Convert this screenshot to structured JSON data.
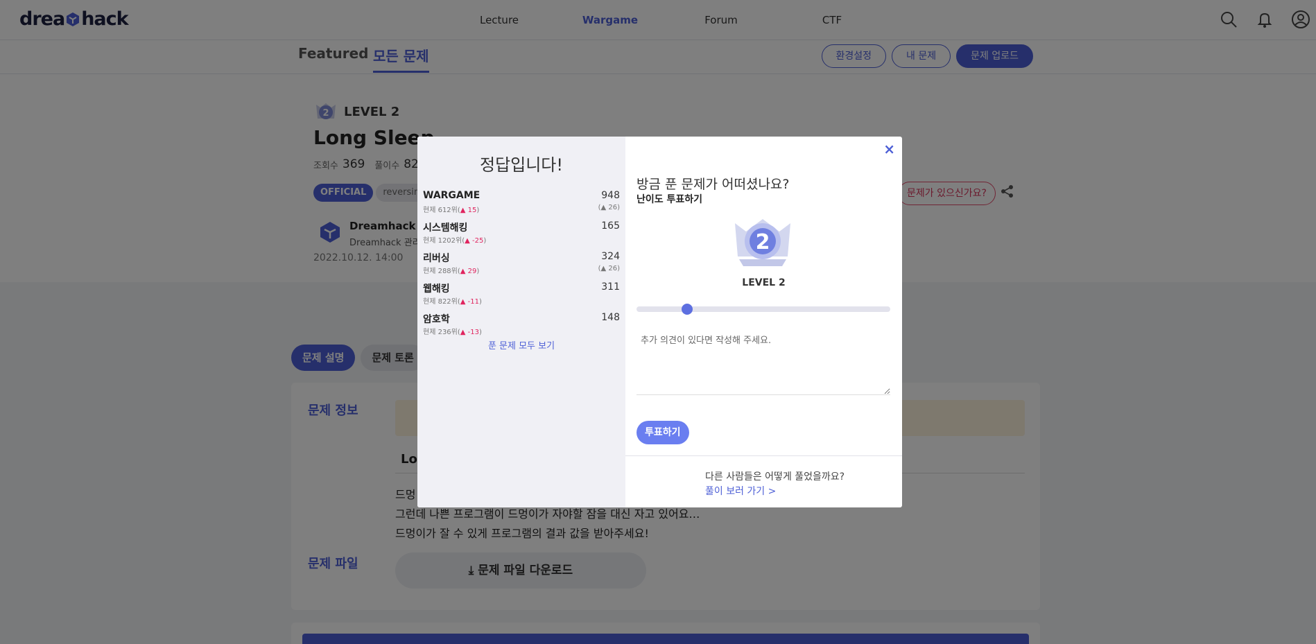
{
  "nav": {
    "logo_left": "drea",
    "logo_right": "hack",
    "links": [
      "Lecture",
      "Wargame",
      "Forum",
      "CTF"
    ],
    "active": "Wargame"
  },
  "subnav": {
    "tabs": [
      "Featured",
      "모든 문제"
    ],
    "buttons": [
      "환경설정",
      "내 문제",
      "문제 업로드"
    ]
  },
  "challenge": {
    "level": "LEVEL 2",
    "title": "Long Sleep",
    "views_label": "조회수",
    "views": "369",
    "solves_label": "풀이수",
    "solves": "82",
    "tags": [
      "OFFICIAL",
      "reversing"
    ],
    "report": "문제가 있으신가요?",
    "author": "Dreamhack",
    "author_role": "Dreamhack 관리자",
    "date": "2022.10.12. 14:00"
  },
  "content": {
    "tabs": [
      "문제 설명",
      "문제 토론"
    ],
    "info_label": "문제 정보",
    "name_partial": "Lo",
    "desc_lines": [
      "드멍",
      "그런데 나쁜 프로그램이 드멍이가 자야할 잠을 대신 자고 있어요…",
      "드멍이가 잘 수 있게 프로그램의 결과 값을 받아주세요!"
    ],
    "file_label": "문제 파일",
    "download": "문제 파일 다운로드"
  },
  "modal": {
    "correct": "정답입니다!",
    "scores": [
      {
        "category": "WARGAME",
        "score": "948",
        "rank": "현제 612위(",
        "change": "▲ 15",
        "close": ")",
        "total": "(▲ 26)"
      },
      {
        "category": "시스템해킹",
        "score": "165",
        "rank": "현제 1202위(",
        "change": "▲ -25",
        "close": ")",
        "total": ""
      },
      {
        "category": "리버싱",
        "score": "324",
        "rank": "현제 288위(",
        "change": "▲ 29",
        "close": ")",
        "total": "(▲ 26)"
      },
      {
        "category": "웹해킹",
        "score": "311",
        "rank": "현제 822위(",
        "change": "▲ -11",
        "close": ")",
        "total": ""
      },
      {
        "category": "암호학",
        "score": "148",
        "rank": "현제 236위(",
        "change": "▲ -13",
        "close": ")",
        "total": ""
      }
    ],
    "see_all": "푼 문제 모두 보기",
    "close": "×",
    "question": "방금 푼 문제가 어떠셨나요?",
    "vote_label": "난이도 투표하기",
    "badge_number": "2",
    "level": "LEVEL 2",
    "slider_value": 2,
    "slider_max": 10,
    "comment_placeholder": "추가 의견이 있다면 작성해 주세요.",
    "vote_button": "투표하기",
    "others_question": "다른 사람들은 어떻게 풀었을까요?",
    "others_link": "풀이 보러 가기 >"
  },
  "colors": {
    "accent": "#4d5fd6",
    "danger": "#e0245e",
    "notice": "#fdf2dd"
  }
}
